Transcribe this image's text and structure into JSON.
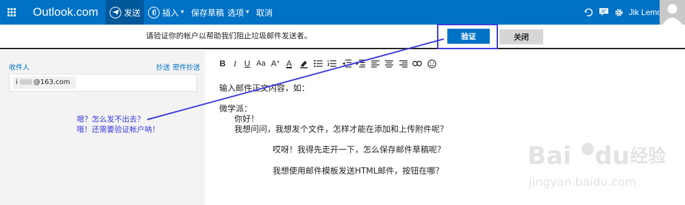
{
  "topbar": {
    "brand": "Outlook.com",
    "send_label": "发送",
    "insert_label": "插入",
    "save_draft_label": "保存草稿",
    "options_label": "选项",
    "cancel_label": "取消",
    "user_name": "Jik Lemon",
    "accent_color": "#0072c6"
  },
  "notice": {
    "message": "请验证你的帐户以帮助我们阻止垃圾邮件发送者。",
    "verify_label": "验证",
    "close_label": "关闭"
  },
  "compose": {
    "to_label": "收件人",
    "cc_label": "抄送",
    "bcc_label": "密件抄送",
    "recipient_suffix": "@163.com",
    "recipient_prefix": "i"
  },
  "annotation": {
    "line1": "嗯？怎么发不出去？",
    "line2": "哦！还需要验证帐户呐！"
  },
  "toolbar": {
    "bold": "B",
    "italic": "I",
    "underline": "U",
    "font_size": "Aa",
    "grow_font": "A",
    "font_color": "A"
  },
  "body": {
    "line1": "输入邮件正文内容，如：",
    "line2": "微学派：",
    "line3": "你好！",
    "line4": "我想问问，我想发个文件，怎样才能在添加和上传附件呢？",
    "line5": "哎呀！我得先走开一下，怎么保存邮件草稿呢？",
    "line6": "我想使用邮件模板发送HTML邮件，按钮在哪？"
  },
  "watermark": {
    "logo_text": "Bai",
    "logo_text2": "du",
    "logo_cn": "经验",
    "url": "jingyan.baidu.com"
  }
}
